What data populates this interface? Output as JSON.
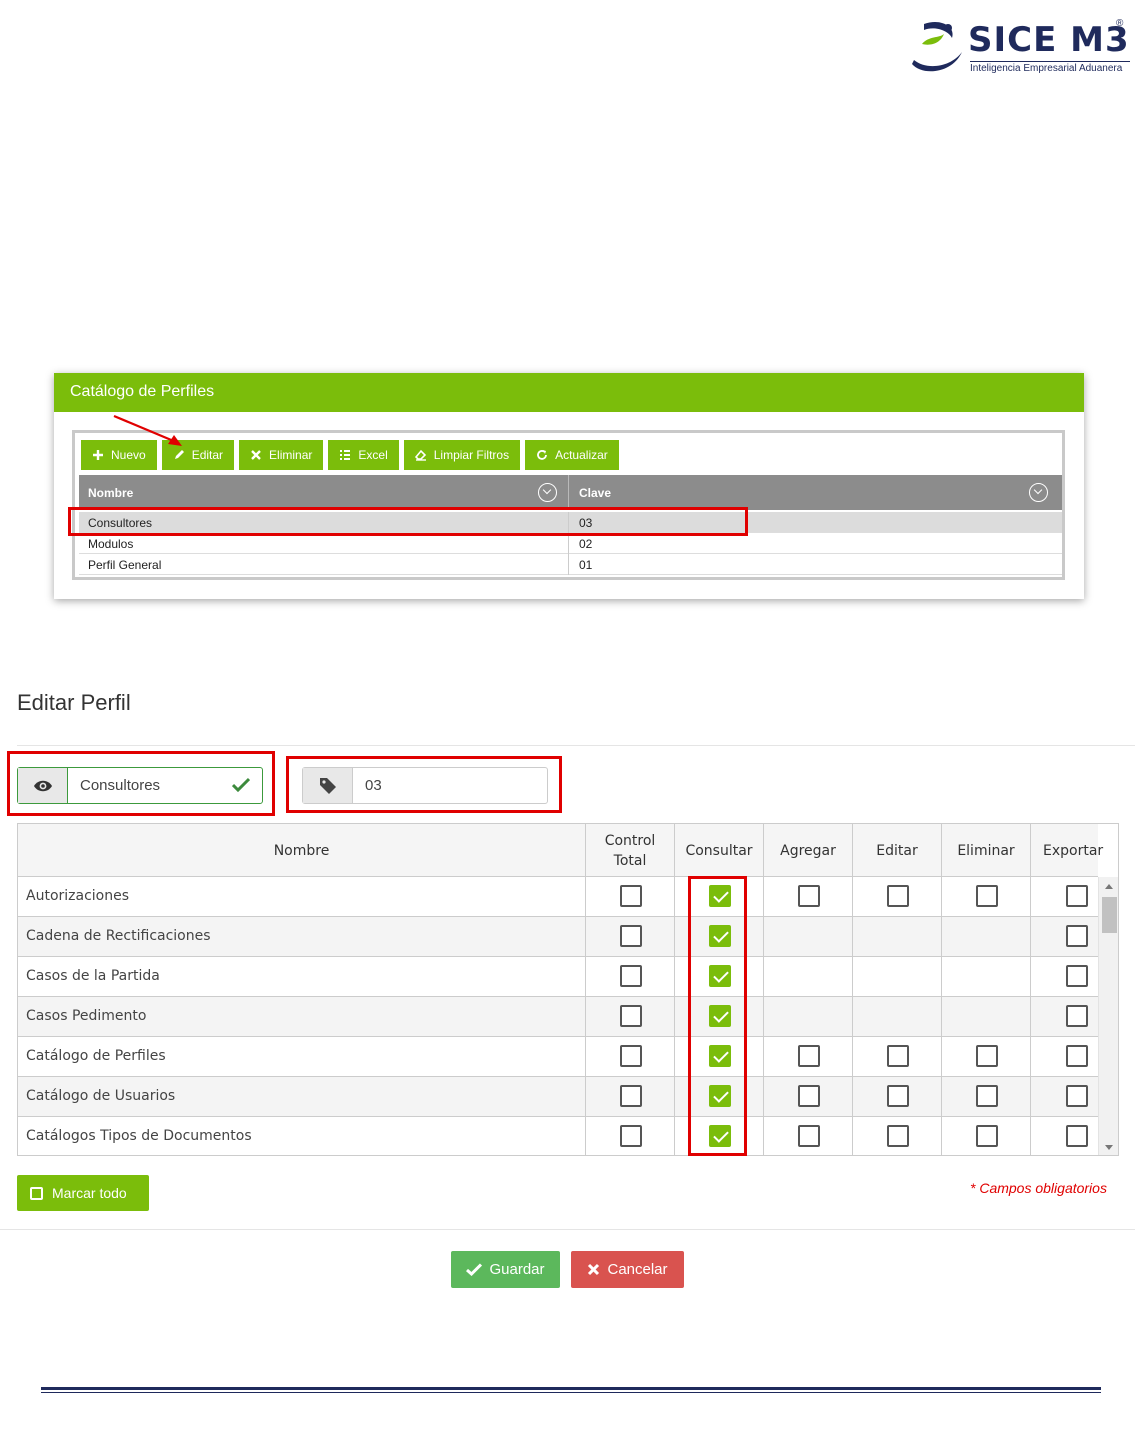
{
  "logo": {
    "brand": "SICE M3",
    "registered": "®",
    "tagline": "Inteligencia Empresarial Aduanera"
  },
  "catalog_panel": {
    "title": "Catálogo de Perfiles",
    "toolbar": {
      "nuevo": "Nuevo",
      "editar": "Editar",
      "eliminar": "Eliminar",
      "excel": "Excel",
      "limpiar": "Limpiar Filtros",
      "actualizar": "Actualizar"
    },
    "columns": [
      "Nombre",
      "Clave"
    ],
    "rows": [
      {
        "nombre": "Consultores",
        "clave": "03",
        "selected": true
      },
      {
        "nombre": "Modulos",
        "clave": "02"
      },
      {
        "nombre": "Perfil General",
        "clave": "01"
      }
    ]
  },
  "edit_form": {
    "title": "Editar Perfil",
    "nombre_value": "Consultores",
    "clave_value": "03",
    "table_headers": {
      "nombre": "Nombre",
      "control_1": "Control",
      "control_2": "Total",
      "consultar": "Consultar",
      "agregar": "Agregar",
      "editar": "Editar",
      "eliminar": "Eliminar",
      "exportar": "Exportar"
    },
    "permissions": [
      {
        "name": "Autorizaciones",
        "control_total": false,
        "consultar": true,
        "agregar": false,
        "editar": false,
        "eliminar": false,
        "exportar": false
      },
      {
        "name": "Cadena de Rectificaciones",
        "control_total": false,
        "consultar": true,
        "agregar": null,
        "editar": null,
        "eliminar": null,
        "exportar": false
      },
      {
        "name": "Casos de la Partida",
        "control_total": false,
        "consultar": true,
        "agregar": null,
        "editar": null,
        "eliminar": null,
        "exportar": false
      },
      {
        "name": "Casos Pedimento",
        "control_total": false,
        "consultar": true,
        "agregar": null,
        "editar": null,
        "eliminar": null,
        "exportar": false
      },
      {
        "name": "Catálogo de Perfiles",
        "control_total": false,
        "consultar": true,
        "agregar": false,
        "editar": false,
        "eliminar": false,
        "exportar": false
      },
      {
        "name": "Catálogo de Usuarios",
        "control_total": false,
        "consultar": true,
        "agregar": false,
        "editar": false,
        "eliminar": false,
        "exportar": false
      },
      {
        "name": "Catálogos Tipos de Documentos",
        "control_total": false,
        "consultar": true,
        "agregar": false,
        "editar": false,
        "eliminar": false,
        "exportar": false
      }
    ],
    "mark_all": "Marcar todo",
    "required_note": "* Campos obligatorios",
    "save": "Guardar",
    "cancel": "Cancelar"
  },
  "colors": {
    "accent_green": "#7bbd0b",
    "highlight_red": "#e00000",
    "save_green": "#5cb85c",
    "cancel_red": "#d9534f",
    "brand_navy": "#1f2a5c"
  }
}
